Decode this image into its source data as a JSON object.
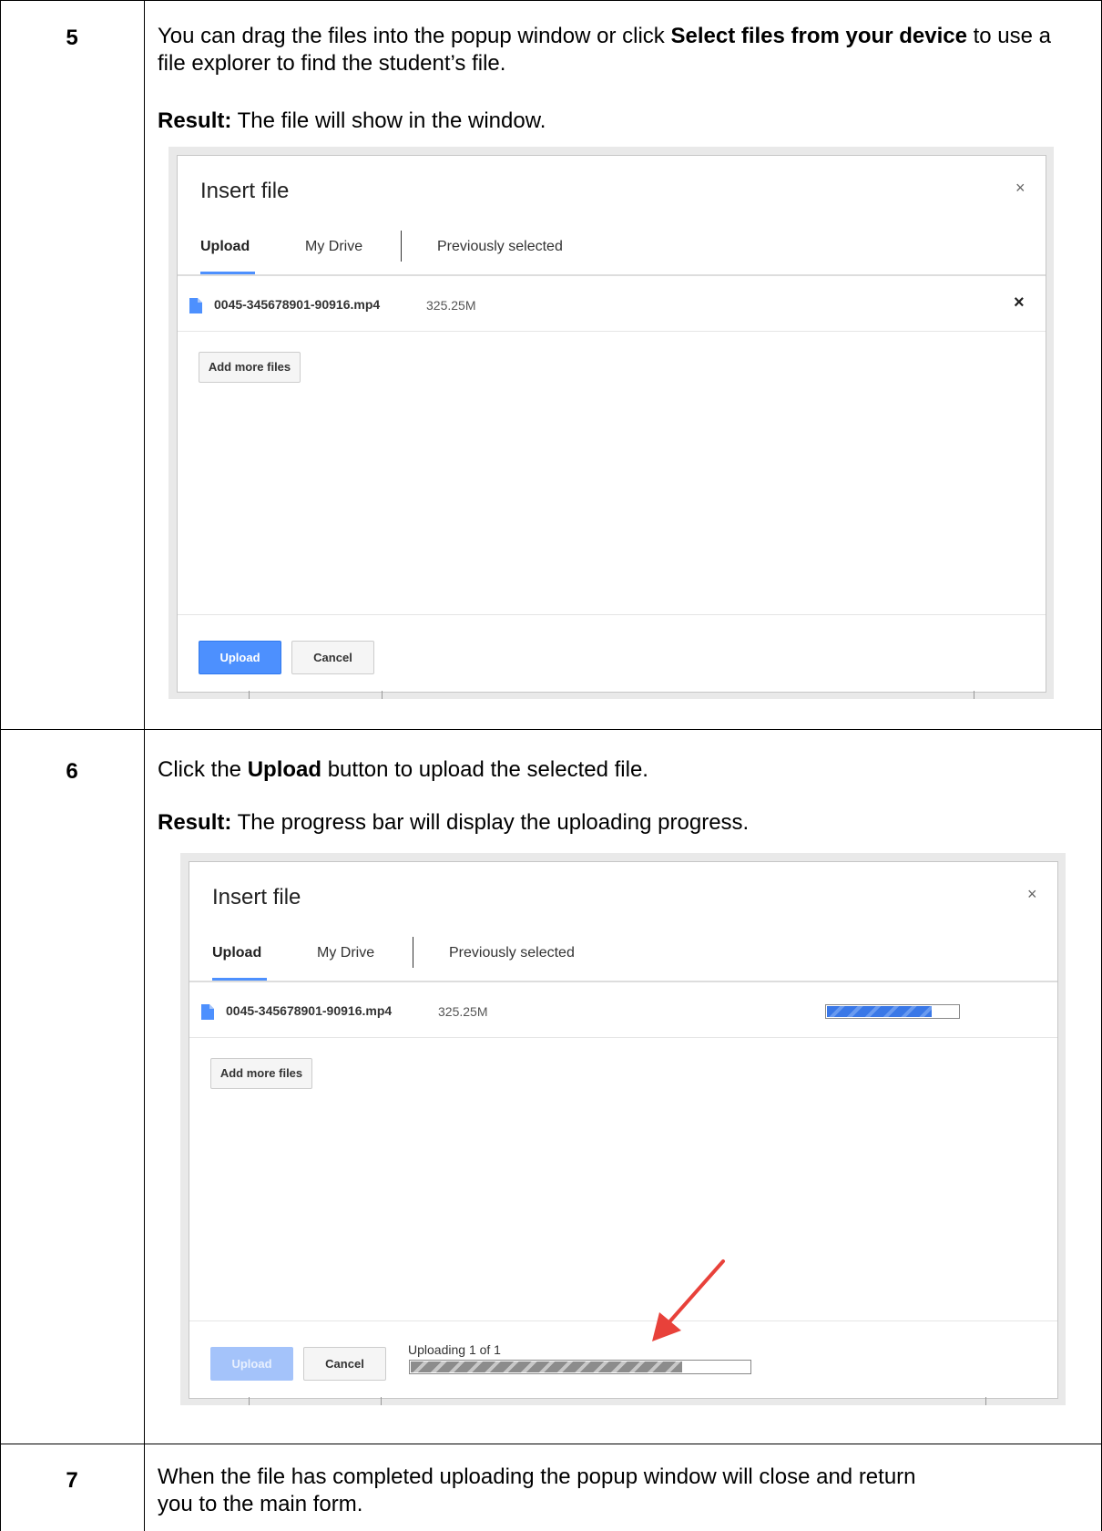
{
  "steps": [
    {
      "number": "5",
      "instruction": {
        "pre": "You can drag the files into the popup window or click ",
        "bold": "Select files from your device",
        "post": " to use a file explorer to find the student’s file."
      },
      "result_label": "Result:",
      "result_text": " The file will show in the window."
    },
    {
      "number": "6",
      "instruction": {
        "pre": "Click the ",
        "bold": "Upload",
        "post": " button to upload the selected file."
      },
      "result_label": "Result:",
      "result_text": " The progress bar will display the uploading progress."
    },
    {
      "number": "7",
      "instruction_line1": "When the file has completed uploading the popup window will close and return",
      "instruction_line2": "you to the main form."
    }
  ],
  "dialog1": {
    "title": "Insert file",
    "close_icon": "×",
    "tabs": [
      "Upload",
      "My Drive",
      "Previously selected"
    ],
    "file_name": "0045-345678901-90916.mp4",
    "file_size": "325.25M",
    "remove_icon": "×",
    "add_more_label": "Add more files",
    "upload_label": "Upload",
    "cancel_label": "Cancel"
  },
  "dialog2": {
    "title": "Insert file",
    "close_icon": "×",
    "tabs": [
      "Upload",
      "My Drive",
      "Previously selected"
    ],
    "file_name": "0045-345678901-90916.mp4",
    "file_size": "325.25M",
    "file_progress": 0.8,
    "add_more_label": "Add more files",
    "upload_label": "Upload",
    "cancel_label": "Cancel",
    "status_text": "Uploading 1 of 1",
    "overall_progress": 0.8
  },
  "colors": {
    "accent": "#4d90fe",
    "arrow": "#e8413a",
    "progress_blue": "#3a78e7",
    "progress_gray": "#8c8c8c"
  },
  "icons": {
    "file": "file-icon",
    "close": "close-icon",
    "remove": "remove-file-icon",
    "arrow": "red-arrow-annotation"
  }
}
